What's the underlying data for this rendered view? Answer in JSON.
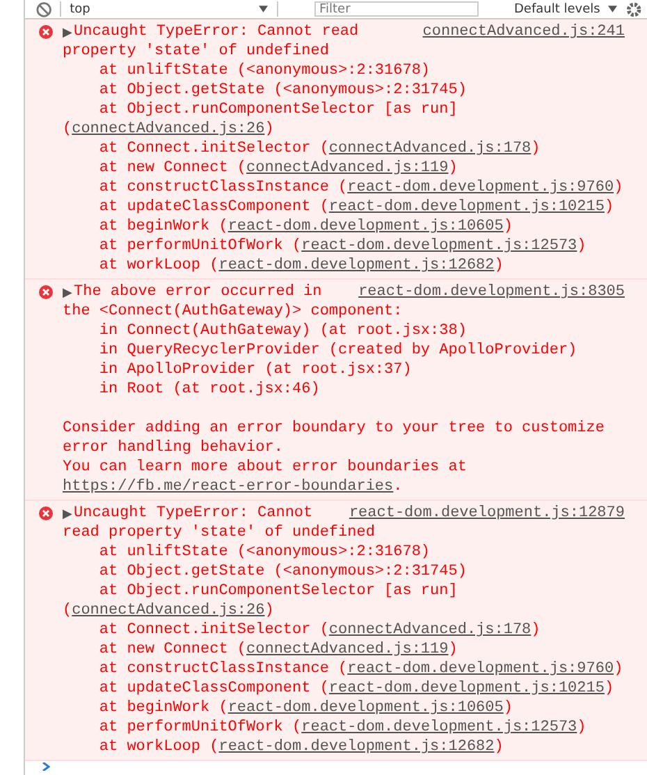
{
  "toolbar": {
    "context": "top",
    "filter": {
      "placeholder": "Filter"
    },
    "levels": "Default levels"
  },
  "messages": [
    {
      "expanded": false,
      "toggle": "▶",
      "source": "connectAdvanced.js:241",
      "text_lines": [
        "Uncaught TypeError: Cannot read",
        "property 'state' of undefined"
      ],
      "stack": [
        {
          "text": "at unliftState (<anonymous>:2:31678)"
        },
        {
          "text": "at Object.getState (<anonymous>:2:31745)"
        },
        {
          "text": "at Object.runComponentSelector [as run] (",
          "link": "connectAdvanced.js:26",
          "after": ")"
        },
        {
          "text": "at Connect.initSelector (",
          "link": "connectAdvanced.js:178",
          "after": ")"
        },
        {
          "text": "at new Connect (",
          "link": "connectAdvanced.js:119",
          "after": ")"
        },
        {
          "text": "at constructClassInstance (",
          "link": "react-dom.development.js:9760",
          "after": ")"
        },
        {
          "text": "at updateClassComponent (",
          "link": "react-dom.development.js:10215",
          "after": ")"
        },
        {
          "text": "at beginWork (",
          "link": "react-dom.development.js:10605",
          "after": ")"
        },
        {
          "text": "at performUnitOfWork (",
          "link": "react-dom.development.js:12573",
          "after": ")"
        },
        {
          "text": "at workLoop (",
          "link": "react-dom.development.js:12682",
          "after": ")"
        }
      ]
    },
    {
      "expanded": false,
      "toggle": "▶",
      "source": "react-dom.development.js:8305",
      "text_lines": [
        "The above error occurred in",
        "the <Connect(AuthGateway)> component:"
      ],
      "stack": [
        {
          "text": "in Connect(AuthGateway) (at root.jsx:38)"
        },
        {
          "text": "in QueryRecyclerProvider (created by ApolloProvider)"
        },
        {
          "text": "in ApolloProvider (at root.jsx:37)"
        },
        {
          "text": "in Root (at root.jsx:46)"
        }
      ],
      "paragraphs": [
        {
          "text": "Consider adding an error boundary to your tree to customize error handling behavior."
        },
        {
          "text": "You can learn more about error boundaries at ",
          "link": "https://fb.me/react-error-boundaries",
          "after": "."
        }
      ]
    },
    {
      "expanded": false,
      "toggle": "▶",
      "source": "react-dom.development.js:12879",
      "text_lines": [
        "Uncaught TypeError: Cannot",
        "read property 'state' of undefined"
      ],
      "stack": [
        {
          "text": "at unliftState (<anonymous>:2:31678)"
        },
        {
          "text": "at Object.getState (<anonymous>:2:31745)"
        },
        {
          "text": "at Object.runComponentSelector [as run] (",
          "link": "connectAdvanced.js:26",
          "after": ")"
        },
        {
          "text": "at Connect.initSelector (",
          "link": "connectAdvanced.js:178",
          "after": ")"
        },
        {
          "text": "at new Connect (",
          "link": "connectAdvanced.js:119",
          "after": ")"
        },
        {
          "text": "at constructClassInstance (",
          "link": "react-dom.development.js:9760",
          "after": ")"
        },
        {
          "text": "at updateClassComponent (",
          "link": "react-dom.development.js:10215",
          "after": ")"
        },
        {
          "text": "at beginWork (",
          "link": "react-dom.development.js:10605",
          "after": ")"
        },
        {
          "text": "at performUnitOfWork (",
          "link": "react-dom.development.js:12573",
          "after": ")"
        },
        {
          "text": "at workLoop (",
          "link": "react-dom.development.js:12682",
          "after": ")"
        }
      ]
    }
  ]
}
